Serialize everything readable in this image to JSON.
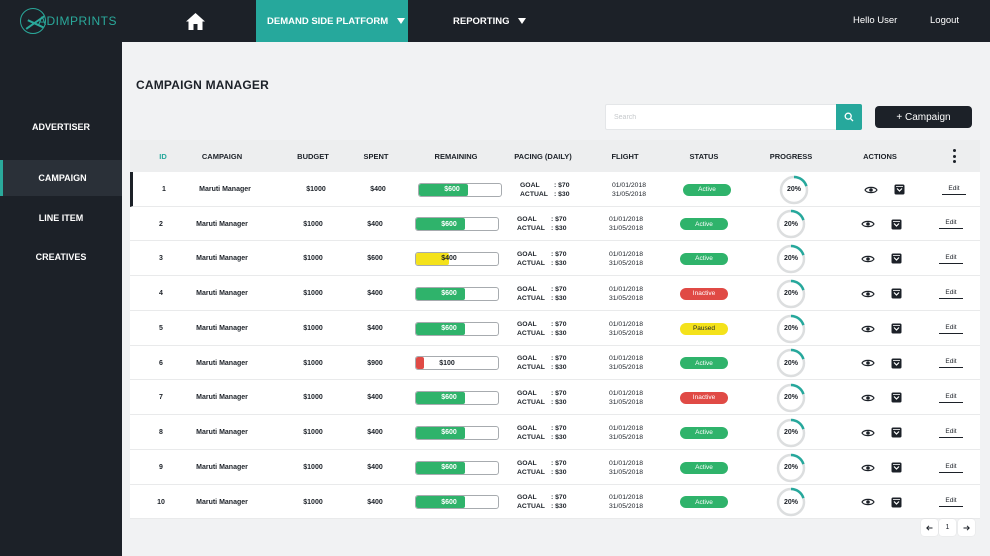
{
  "brand": {
    "logo_text": "ADIMPRINTS",
    "accent": "#26a89c",
    "dark": "#1c2128"
  },
  "topnav": {
    "home_icon": "home-icon",
    "dsp_label": "DEMAND SIDE PLATFORM",
    "reporting_label": "REPORTING",
    "user_greeting": "Hello User",
    "logout_label": "Logout"
  },
  "sidebar": {
    "items": [
      {
        "label": "ADVERTISER",
        "active": false
      },
      {
        "label": "CAMPAIGN",
        "active": true
      },
      {
        "label": "LINE ITEM",
        "active": false
      },
      {
        "label": "CREATIVES",
        "active": false
      }
    ]
  },
  "main": {
    "title": "CAMPAIGN MANAGER",
    "search_placeholder": "Search",
    "add_campaign_label": "+ Campaign"
  },
  "table": {
    "columns": [
      "ID",
      "CAMPAIGN",
      "BUDGET",
      "SPENT",
      "REMAINING",
      "PACING (DAILY)",
      "FLIGHT",
      "STATUS",
      "PROGRESS",
      "ACTIONS"
    ],
    "pacing_goal_label": "GOAL",
    "pacing_actual_label": "ACTUAL",
    "edit_label": "Edit",
    "status_colors": {
      "Active": "#2fb36b",
      "Inactive": "#e04a45",
      "Paused": "#f4e21b"
    },
    "rows": [
      {
        "id": "1",
        "campaign": "Maruti Manager",
        "budget": "$1000",
        "spent": "$400",
        "remaining": "$600",
        "remaining_fraction": 0.6,
        "bar_color": "#2fb36b",
        "goal": ": $70",
        "actual": ": $30",
        "flight_start": "01/01/2018",
        "flight_end": "31/05/2018",
        "status": "Active",
        "progress": "20%",
        "progress_fraction": 0.2
      },
      {
        "id": "2",
        "campaign": "Maruti Manager",
        "budget": "$1000",
        "spent": "$400",
        "remaining": "$600",
        "remaining_fraction": 0.6,
        "bar_color": "#2fb36b",
        "goal": ": $70",
        "actual": ": $30",
        "flight_start": "01/01/2018",
        "flight_end": "31/05/2018",
        "status": "Active",
        "progress": "20%",
        "progress_fraction": 0.2
      },
      {
        "id": "3",
        "campaign": "Maruti Manager",
        "budget": "$1000",
        "spent": "$600",
        "remaining": "$400",
        "remaining_fraction": 0.4,
        "bar_color": "#f4e21b",
        "goal": ": $70",
        "actual": ": $30",
        "flight_start": "01/01/2018",
        "flight_end": "31/05/2018",
        "status": "Active",
        "progress": "20%",
        "progress_fraction": 0.2
      },
      {
        "id": "4",
        "campaign": "Maruti Manager",
        "budget": "$1000",
        "spent": "$400",
        "remaining": "$600",
        "remaining_fraction": 0.6,
        "bar_color": "#2fb36b",
        "goal": ": $70",
        "actual": ": $30",
        "flight_start": "01/01/2018",
        "flight_end": "31/05/2018",
        "status": "Inactive",
        "progress": "20%",
        "progress_fraction": 0.2
      },
      {
        "id": "5",
        "campaign": "Maruti Manager",
        "budget": "$1000",
        "spent": "$400",
        "remaining": "$600",
        "remaining_fraction": 0.6,
        "bar_color": "#2fb36b",
        "goal": ": $70",
        "actual": ": $30",
        "flight_start": "01/01/2018",
        "flight_end": "31/05/2018",
        "status": "Paused",
        "progress": "20%",
        "progress_fraction": 0.2
      },
      {
        "id": "6",
        "campaign": "Maruti Manager",
        "budget": "$1000",
        "spent": "$900",
        "remaining": "$100",
        "remaining_fraction": 0.1,
        "bar_color": "#e04a45",
        "goal": ": $70",
        "actual": ": $30",
        "flight_start": "01/01/2018",
        "flight_end": "31/05/2018",
        "status": "Active",
        "progress": "20%",
        "progress_fraction": 0.2
      },
      {
        "id": "7",
        "campaign": "Maruti Manager",
        "budget": "$1000",
        "spent": "$400",
        "remaining": "$600",
        "remaining_fraction": 0.6,
        "bar_color": "#2fb36b",
        "goal": ": $70",
        "actual": ": $30",
        "flight_start": "01/01/2018",
        "flight_end": "31/05/2018",
        "status": "Inactive",
        "progress": "20%",
        "progress_fraction": 0.2
      },
      {
        "id": "8",
        "campaign": "Maruti Manager",
        "budget": "$1000",
        "spent": "$400",
        "remaining": "$600",
        "remaining_fraction": 0.6,
        "bar_color": "#2fb36b",
        "goal": ": $70",
        "actual": ": $30",
        "flight_start": "01/01/2018",
        "flight_end": "31/05/2018",
        "status": "Active",
        "progress": "20%",
        "progress_fraction": 0.2
      },
      {
        "id": "9",
        "campaign": "Maruti Manager",
        "budget": "$1000",
        "spent": "$400",
        "remaining": "$600",
        "remaining_fraction": 0.6,
        "bar_color": "#2fb36b",
        "goal": ": $70",
        "actual": ": $30",
        "flight_start": "01/01/2018",
        "flight_end": "31/05/2018",
        "status": "Active",
        "progress": "20%",
        "progress_fraction": 0.2
      },
      {
        "id": "10",
        "campaign": "Maruti Manager",
        "budget": "$1000",
        "spent": "$400",
        "remaining": "$600",
        "remaining_fraction": 0.6,
        "bar_color": "#2fb36b",
        "goal": ": $70",
        "actual": ": $30",
        "flight_start": "01/01/2018",
        "flight_end": "31/05/2018",
        "status": "Active",
        "progress": "20%",
        "progress_fraction": 0.2
      }
    ]
  },
  "pagination": {
    "prev_icon": "arrow-left-icon",
    "current_page": "1",
    "next_icon": "arrow-right-icon"
  }
}
